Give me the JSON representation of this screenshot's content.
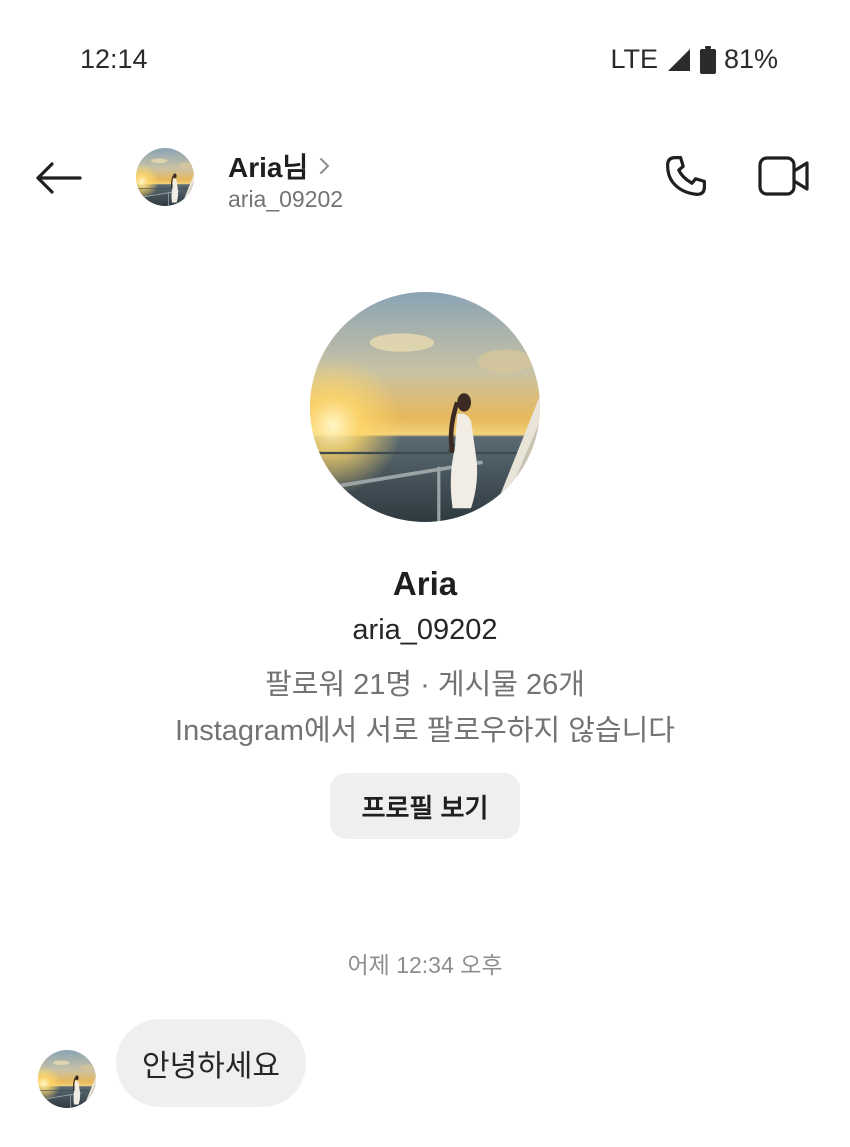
{
  "status_bar": {
    "time": "12:14",
    "network": "LTE",
    "battery": "81%",
    "icons": [
      "signal-icon",
      "battery-icon"
    ]
  },
  "header": {
    "name": "Aria님",
    "username": "aria_09202",
    "icons": [
      "back-arrow-icon",
      "chevron-right-icon",
      "phone-icon",
      "video-camera-icon"
    ]
  },
  "profile": {
    "name": "Aria",
    "username": "aria_09202",
    "stats": "팔로워 21명 · 게시물 26개",
    "follow_note": "Instagram에서 서로 팔로우하지 않습니다",
    "view_profile_label": "프로필 보기"
  },
  "conversation": {
    "timestamp": "어제 12:34 오후",
    "messages": [
      {
        "text": "안녕하세요",
        "from": "Aria"
      }
    ]
  },
  "colors": {
    "text_primary": "#262626",
    "text_secondary": "#737373",
    "bubble_bg": "#efefef",
    "button_bg": "#efefef"
  }
}
